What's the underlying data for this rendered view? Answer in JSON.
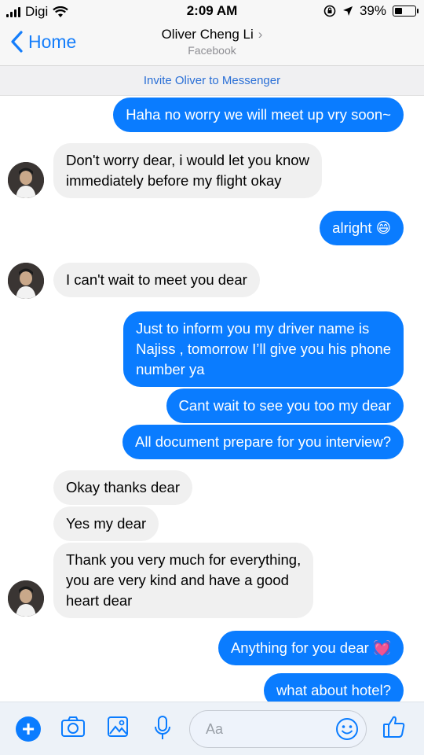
{
  "status_bar": {
    "carrier": "Digi",
    "time": "2:09 AM",
    "battery": "39%",
    "battery_fraction": 0.39
  },
  "header": {
    "back_label": "Home",
    "contact_name": "Oliver Cheng Li",
    "subtitle": "Facebook"
  },
  "invite_banner": "Invite Oliver to Messenger",
  "messages": [
    {
      "from": "me",
      "text": "Haha no worry we will meet up vry soon~"
    },
    {
      "from": "them",
      "lines": [
        "Don't worry dear, i would let you know",
        "immediately before my flight okay"
      ]
    },
    {
      "from": "me",
      "text": "alright",
      "emoji": "😄"
    },
    {
      "from": "them",
      "text": "I can't wait to meet you dear"
    },
    {
      "from": "me",
      "lines": [
        "Just to inform you my driver name is",
        "Najiss  , tomorrow I’ll give you his phone",
        "number ya"
      ]
    },
    {
      "from": "me",
      "text": "Cant wait to see you too my dear"
    },
    {
      "from": "me",
      "text": "All document prepare for you interview?"
    },
    {
      "from": "them",
      "text": "Okay thanks dear"
    },
    {
      "from": "them",
      "text": "Yes my dear"
    },
    {
      "from": "them",
      "lines": [
        "Thank you very much for everything,",
        "you are very kind and have a good",
        "heart dear"
      ]
    },
    {
      "from": "me",
      "text": "Anything for you dear",
      "emoji": "💓"
    },
    {
      "from": "me",
      "text": "what about hotel?"
    }
  ],
  "composer": {
    "placeholder": "Aa"
  },
  "colors": {
    "accent": "#0a7cff",
    "incoming_bubble": "#f0f0f0"
  }
}
